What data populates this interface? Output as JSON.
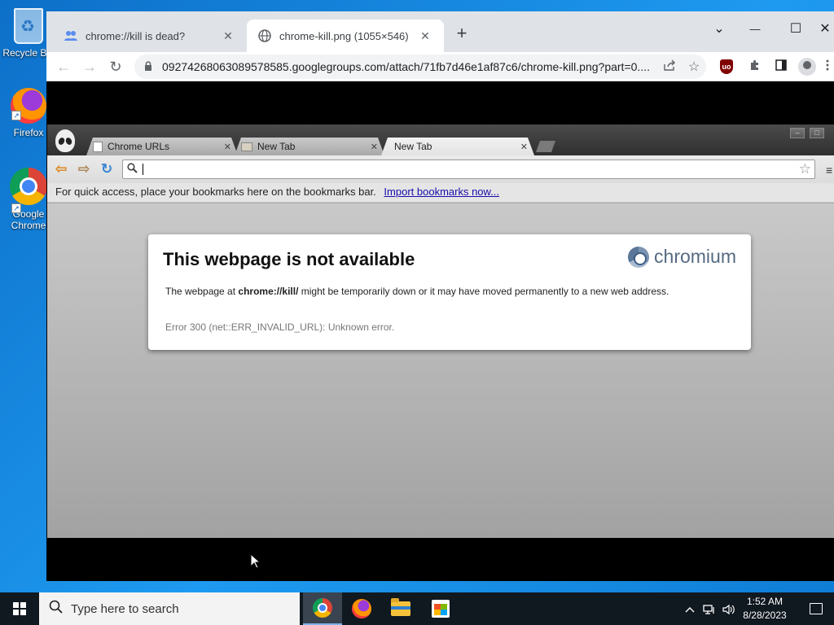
{
  "desktop": {
    "icons": [
      {
        "label": "Recycle Bin",
        "icon": "recycle-bin-icon"
      },
      {
        "label": "Firefox",
        "icon": "firefox-icon"
      },
      {
        "label": "Google Chrome",
        "icon": "chrome-icon"
      }
    ]
  },
  "browser": {
    "tabs": [
      {
        "title": "chrome://kill is dead?",
        "icon": "groups-icon",
        "active": false
      },
      {
        "title": "chrome-kill.png (1055×546)",
        "icon": "globe-icon",
        "active": true
      }
    ],
    "close_glyph": "✕",
    "new_tab_glyph": "+",
    "window_controls": {
      "tab_search": "⌄",
      "minimize": "—",
      "maximize": "☐",
      "close": "✕"
    },
    "nav": {
      "back": "←",
      "forward": "→",
      "reload": "↻"
    },
    "address": {
      "lock_icon": "🔒",
      "url": "09274268063089578585.googlegroups.com/attach/71fb7d46e1af87c6/chrome-kill.png?part=0...."
    },
    "toolbar_icons": [
      "share-icon",
      "bookmark-star-icon",
      "ublock-icon",
      "extensions-icon",
      "side-panel-icon",
      "profile-icon",
      "menu-icon"
    ],
    "ublock_text": "uo"
  },
  "screenshot": {
    "tabs": [
      {
        "title": "Chrome URLs",
        "selected": false
      },
      {
        "title": "New Tab",
        "selected": false
      },
      {
        "title": "New Tab",
        "selected": true
      }
    ],
    "tab_close": "✕",
    "nav": {
      "back": "⇦",
      "forward": "⇨",
      "reload": "↻"
    },
    "search_glyph": "⚲",
    "star_glyph": "☆",
    "menu_glyph": "≡",
    "bookmarks_bar": {
      "text": "For quick access, place your bookmarks here on the bookmarks bar.",
      "link": "Import bookmarks now..."
    },
    "error": {
      "title": "This webpage is not available",
      "brand": "chromium",
      "message_prefix": "The webpage at ",
      "message_url": "chrome://kill/",
      "message_suffix": " might be temporarily down or it may have moved permanently to a new web address.",
      "code": "Error 300 (net::ERR_INVALID_URL): Unknown error."
    }
  },
  "taskbar": {
    "search_placeholder": "Type here to search",
    "apps": [
      {
        "name": "chrome-taskbar-icon",
        "active": true
      },
      {
        "name": "firefox-taskbar-icon",
        "active": false
      },
      {
        "name": "file-explorer-taskbar-icon",
        "active": false
      },
      {
        "name": "store-taskbar-icon",
        "active": false
      }
    ],
    "tray": {
      "chevron": "^",
      "network": "🖧",
      "volume": "🔊"
    },
    "time": "1:52 AM",
    "date": "8/28/2023"
  },
  "colors": {
    "desktop_blue": "#1a8fe0",
    "taskbar": "#101820",
    "chrome_tabbar": "#dfe3e7",
    "link": "#1a0dab"
  }
}
